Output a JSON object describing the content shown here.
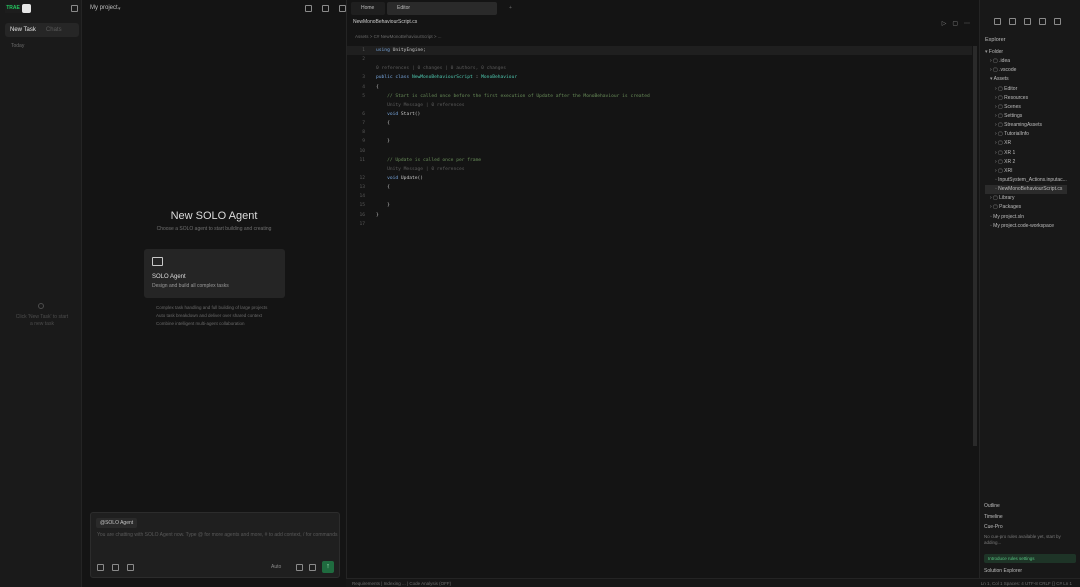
{
  "sidebar": {
    "logo": "TRAE",
    "tabs": [
      {
        "label": "New Task",
        "active": true
      },
      {
        "label": "Chats",
        "active": false
      }
    ],
    "section_label": "Today",
    "empty_text": "Click 'New Task' to start a new task"
  },
  "agent": {
    "project_title": "My project",
    "title": "New SOLO Agent",
    "subtitle": "Choose a SOLO agent to start building and creating",
    "card": {
      "name": "SOLO Agent",
      "description": "Design and build all complex tasks"
    },
    "features": [
      "Complex task handling and full building of large projects",
      "Auto task breakdown and deliver over shared context",
      "Combine intelligent multi-agent collaboration"
    ],
    "input": {
      "chip": "@SOLO Agent",
      "placeholder": "You are chatting with SOLO Agent now. Type @ for more agents and more, # to add context, / for commands",
      "model": "Auto"
    }
  },
  "editor": {
    "window_tabs": [
      "Home",
      "Editor"
    ],
    "file_tab": "NewMonoBehaviourScript.cs",
    "breadcrumb": "Assets > C# NewMonoBehaviourScript > ...",
    "code": [
      {
        "n": "1",
        "parts": [
          [
            "kw",
            "using"
          ],
          [
            "pl",
            " UnityEngine;"
          ]
        ],
        "hl": true
      },
      {
        "n": "2",
        "parts": []
      },
      {
        "n": "",
        "parts": [
          [
            "dim",
            "0 references | 0 changes | 0 authors, 0 changes"
          ]
        ]
      },
      {
        "n": "3",
        "parts": [
          [
            "kw",
            "public class "
          ],
          [
            "ty",
            "NewMonoBehaviourScript"
          ],
          [
            "pl",
            " : "
          ],
          [
            "ty",
            "MonoBehaviour"
          ]
        ]
      },
      {
        "n": "4",
        "parts": [
          [
            "pl",
            "{"
          ]
        ]
      },
      {
        "n": "5",
        "parts": [
          [
            "cm",
            "    // Start is called once before the first execution of Update after the MonoBehaviour is created"
          ]
        ]
      },
      {
        "n": "",
        "parts": [
          [
            "dim",
            "    Unity Message | 0 references"
          ]
        ]
      },
      {
        "n": "6",
        "parts": [
          [
            "kw",
            "    void "
          ],
          [
            "pl",
            "Start()"
          ]
        ]
      },
      {
        "n": "7",
        "parts": [
          [
            "pl",
            "    {"
          ]
        ]
      },
      {
        "n": "8",
        "parts": []
      },
      {
        "n": "9",
        "parts": [
          [
            "pl",
            "    }"
          ]
        ]
      },
      {
        "n": "10",
        "parts": []
      },
      {
        "n": "11",
        "parts": [
          [
            "cm",
            "    // Update is called once per frame"
          ]
        ]
      },
      {
        "n": "",
        "parts": [
          [
            "dim",
            "    Unity Message | 0 references"
          ]
        ]
      },
      {
        "n": "12",
        "parts": [
          [
            "kw",
            "    void "
          ],
          [
            "pl",
            "Update()"
          ]
        ]
      },
      {
        "n": "13",
        "parts": [
          [
            "pl",
            "    {"
          ]
        ]
      },
      {
        "n": "14",
        "parts": []
      },
      {
        "n": "15",
        "parts": [
          [
            "pl",
            "    }"
          ]
        ]
      },
      {
        "n": "16",
        "parts": [
          [
            "pl",
            "}"
          ]
        ]
      },
      {
        "n": "17",
        "parts": []
      }
    ]
  },
  "explorer": {
    "title": "Explorer",
    "tree": [
      {
        "label": "Folder",
        "depth": 0,
        "kind": "open"
      },
      {
        "label": ".idea",
        "depth": 1,
        "kind": "folder"
      },
      {
        "label": ".vscode",
        "depth": 1,
        "kind": "folder"
      },
      {
        "label": "Assets",
        "depth": 1,
        "kind": "open"
      },
      {
        "label": "Editor",
        "depth": 2,
        "kind": "folder"
      },
      {
        "label": "Resources",
        "depth": 2,
        "kind": "folder"
      },
      {
        "label": "Scenes",
        "depth": 2,
        "kind": "folder"
      },
      {
        "label": "Settings",
        "depth": 2,
        "kind": "folder"
      },
      {
        "label": "StreamingAssets",
        "depth": 2,
        "kind": "folder"
      },
      {
        "label": "TutorialInfo",
        "depth": 2,
        "kind": "folder"
      },
      {
        "label": "XR",
        "depth": 2,
        "kind": "folder"
      },
      {
        "label": "XR 1",
        "depth": 2,
        "kind": "folder"
      },
      {
        "label": "XR 2",
        "depth": 2,
        "kind": "folder"
      },
      {
        "label": "XRI",
        "depth": 2,
        "kind": "folder"
      },
      {
        "label": "InputSystem_Actions.inputac...",
        "depth": 2,
        "kind": "file"
      },
      {
        "label": "NewMonoBehaviourScript.cs",
        "depth": 2,
        "kind": "file",
        "selected": true
      },
      {
        "label": "Library",
        "depth": 1,
        "kind": "folder"
      },
      {
        "label": "Packages",
        "depth": 1,
        "kind": "folder"
      },
      {
        "label": "My project.sln",
        "depth": 1,
        "kind": "file"
      },
      {
        "label": "My project.code-workspace",
        "depth": 1,
        "kind": "file"
      }
    ],
    "sections": [
      "Outline",
      "Timeline",
      "Cue-Pro"
    ],
    "cue_text": "No cue-pro rules available yet, start by adding...",
    "cue_button": "Introduce rules settings",
    "solution_explorer": "Solution Explorer"
  },
  "status": {
    "left": "Requirements | Indexing ... | Code Analysis (OFF)",
    "right": "Ln 1, Col 1   Spaces: 4   UTF-8   CRLF   {} C#   Ln 1"
  }
}
